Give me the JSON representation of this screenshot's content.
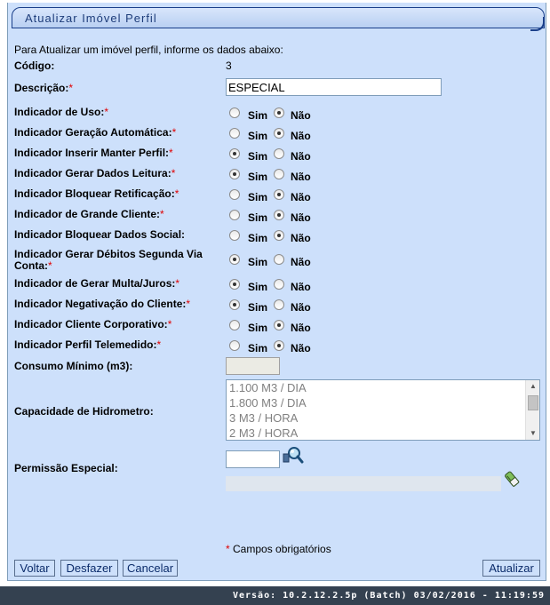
{
  "form": {
    "title": "Atualizar Imóvel Perfil",
    "intro": "Para Atualizar um imóvel perfil, informe os dados abaixo:",
    "codigo_label": "Código:",
    "codigo_value": "3",
    "descricao_label": "Descrição:",
    "descricao_value": "ESPECIAL",
    "required_mark": "*",
    "sim_label": "Sim",
    "nao_label": "Não",
    "indicators": [
      {
        "label": "Indicador de Uso:",
        "required": true,
        "selected": "Não"
      },
      {
        "label": "Indicador Geração Automática:",
        "required": true,
        "selected": "Não"
      },
      {
        "label": "Indicador Inserir Manter Perfil:",
        "required": true,
        "selected": "Sim"
      },
      {
        "label": "Indicador Gerar Dados Leitura:",
        "required": true,
        "selected": "Sim"
      },
      {
        "label": "Indicador Bloquear Retificação:",
        "required": true,
        "selected": "Não"
      },
      {
        "label": "Indicador de Grande Cliente:",
        "required": true,
        "selected": "Não"
      },
      {
        "label": "Indicador Bloquear Dados Social:",
        "required": false,
        "selected": "Não"
      },
      {
        "label_line1": "Indicador Gerar Débitos Segunda Via",
        "label_line2": "Conta:",
        "required": true,
        "selected": "Sim"
      },
      {
        "label": "Indicador de Gerar Multa/Juros:",
        "required": true,
        "selected": "Sim"
      },
      {
        "label": "Indicador Negativação do Cliente:",
        "required": true,
        "selected": "Sim"
      },
      {
        "label": "Indicador Cliente Corporativo:",
        "required": true,
        "selected": "Não"
      },
      {
        "label": "Indicador Perfil Telemedido:",
        "required": true,
        "selected": "Não"
      }
    ],
    "consumo_label": "Consumo Mínimo (m3):",
    "consumo_value": "",
    "capacidade_label": "Capacidade de Hidrometro:",
    "capacidade_options": [
      "1.100 M3 / DIA",
      "1.800 M3 / DIA",
      "3 M3 / HORA",
      "2 M3 / HORA"
    ],
    "permissao_label": "Permissão Especial:",
    "permissao_value": "",
    "required_note": "Campos obrigatórios"
  },
  "buttons": {
    "voltar": "Voltar",
    "desfazer": "Desfazer",
    "cancelar": "Cancelar",
    "atualizar": "Atualizar"
  },
  "footer": {
    "version": "Versão: 10.2.12.2.5p (Batch) 03/02/2016 - 11:19:59"
  },
  "icons": {
    "search": "magnifier-icon",
    "clear": "eraser-icon"
  }
}
